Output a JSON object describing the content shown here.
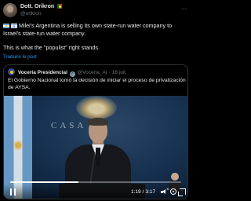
{
  "post": {
    "author_name": "Dott. Orikron",
    "author_handle": "@orikron",
    "more_icon": "more-horizontal-icon",
    "text_line1": "Milei's Argentina is selling its own state-run water company to Israel's state-run water company.",
    "text_line2": "This is what the \"populist\" right stands.",
    "translate_label": "Traduire le post"
  },
  "quoted_post": {
    "author_name": "Vocería Presidencial",
    "author_handle": "@Voceria_Ar",
    "date": "18 juil.",
    "separator": "·",
    "text": "El Gobierno Nacional tomó la decisión de iniciar el proceso de privatización de AYSA."
  },
  "video": {
    "wall_text": "CASA",
    "current_time": "1:19",
    "total_time": "3:17",
    "time_separator": "/",
    "progress": 0.4,
    "muted_glyph": "×"
  }
}
